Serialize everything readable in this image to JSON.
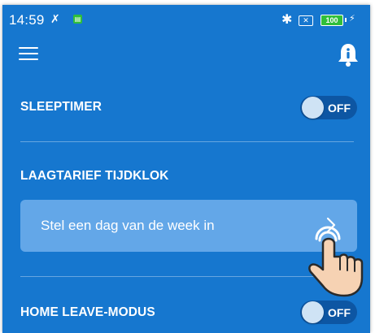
{
  "status_bar": {
    "time": "14:59",
    "no_signal": "✗",
    "battery": "100"
  },
  "header": {
    "menu_icon": "hamburger-menu-icon",
    "info_icon": "bell-info-icon"
  },
  "settings": {
    "sleeptimer": {
      "label": "SLEEPTIMER",
      "state": "OFF"
    },
    "off_peak_clock": {
      "label": "LAAGTARIEF TIJDKLOK",
      "day_field": "Stel een dag van de week in"
    },
    "home_leave": {
      "label": "HOME LEAVE-MODUS",
      "state": "OFF"
    }
  },
  "colors": {
    "background": "#1677cf",
    "field": "#63a7e8",
    "toggle_track": "#0d56a3",
    "toggle_knob": "#cfe3f5"
  }
}
